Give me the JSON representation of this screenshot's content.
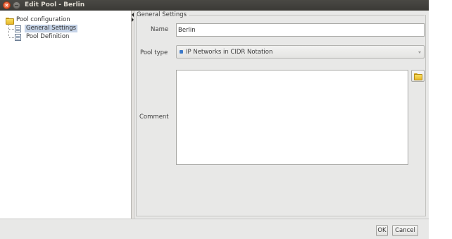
{
  "window": {
    "title": "Edit Pool - Berlin"
  },
  "tree": {
    "root": {
      "label": "Pool configuration",
      "icon": "folder-icon"
    },
    "children": [
      {
        "label": "General Settings",
        "icon": "document-icon",
        "selected": true
      },
      {
        "label": "Pool Definition",
        "icon": "document-icon",
        "selected": false
      }
    ]
  },
  "form": {
    "group_title": "General Settings",
    "name": {
      "label": "Name",
      "value": "Berlin"
    },
    "pool_type": {
      "label": "Pool type",
      "selected": "IP Networks in CIDR Notation",
      "icon": "network-icon"
    },
    "comment": {
      "label": "Comment",
      "value": ""
    },
    "browse_icon": "folder-icon"
  },
  "buttons": {
    "ok": "OK",
    "cancel": "Cancel"
  },
  "colors": {
    "titlebar": "#3b3a36",
    "close_button": "#e0481c",
    "selection": "#c4d2e6",
    "panel_background": "#e8e8e7",
    "network_icon": "#3c79c9"
  }
}
